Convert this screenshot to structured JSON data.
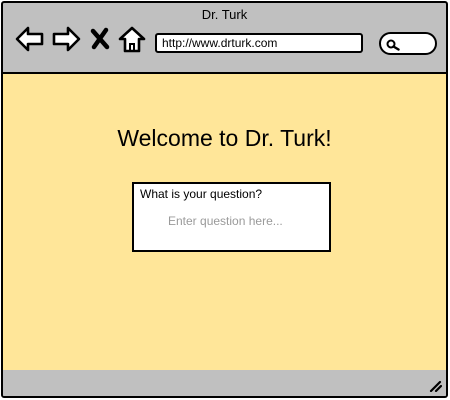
{
  "window": {
    "title": "Dr. Turk"
  },
  "toolbar": {
    "icons": {
      "back": "back-arrow-icon",
      "forward": "forward-arrow-icon",
      "stop": "stop-x-icon",
      "home": "home-icon",
      "search": "search-icon"
    },
    "address": "http://www.drturk.com",
    "search_value": ""
  },
  "content": {
    "welcome": "Welcome to Dr. Turk!",
    "question": {
      "label": "What is your question?",
      "placeholder": "Enter question here...",
      "value": ""
    }
  },
  "status_bar": {
    "grip_icon": "resize-grip-icon"
  },
  "colors": {
    "content_background": "#ffe699",
    "chrome_background": "#c0c0c0"
  }
}
